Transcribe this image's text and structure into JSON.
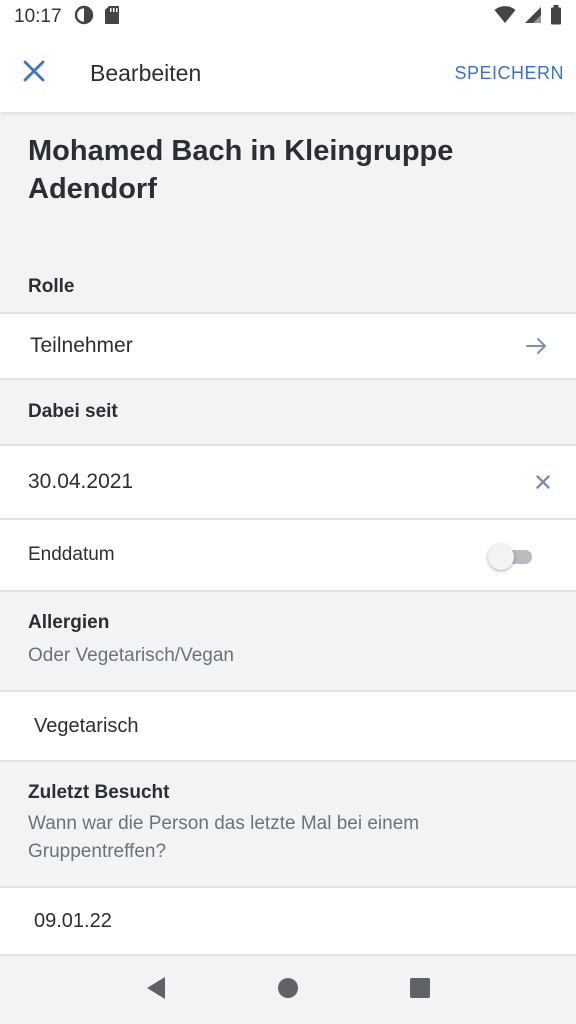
{
  "status_bar": {
    "time": "10:17",
    "icons": [
      "data-saver-icon",
      "sd-card-icon",
      "wifi-icon",
      "signal-icon",
      "battery-icon"
    ]
  },
  "app_bar": {
    "title": "Bearbeiten",
    "save_label": "SPEICHERN",
    "close_icon": "close-icon",
    "accent_color": "#3a73c9"
  },
  "page": {
    "title": "Mohamed Bach in Kleingruppe Adendorf"
  },
  "rolle": {
    "label": "Rolle",
    "value": "Teilnehmer",
    "trailing_icon": "arrow-right-icon"
  },
  "dabei_seit": {
    "label": "Dabei seit",
    "value": "30.04.2021",
    "trailing_icon": "clear-icon"
  },
  "enddatum": {
    "label": "Enddatum",
    "enabled": false
  },
  "allergien": {
    "label": "Allergien",
    "hint": "Oder Vegetarisch/Vegan",
    "value": "Vegetarisch"
  },
  "zuletzt_besucht": {
    "label": "Zuletzt Besucht",
    "hint": "Wann war die Person das letzte Mal bei einem Gruppentreffen?",
    "value": "09.01.22"
  },
  "nav_bar": {
    "buttons": [
      "back-icon",
      "home-icon",
      "recents-icon"
    ]
  }
}
